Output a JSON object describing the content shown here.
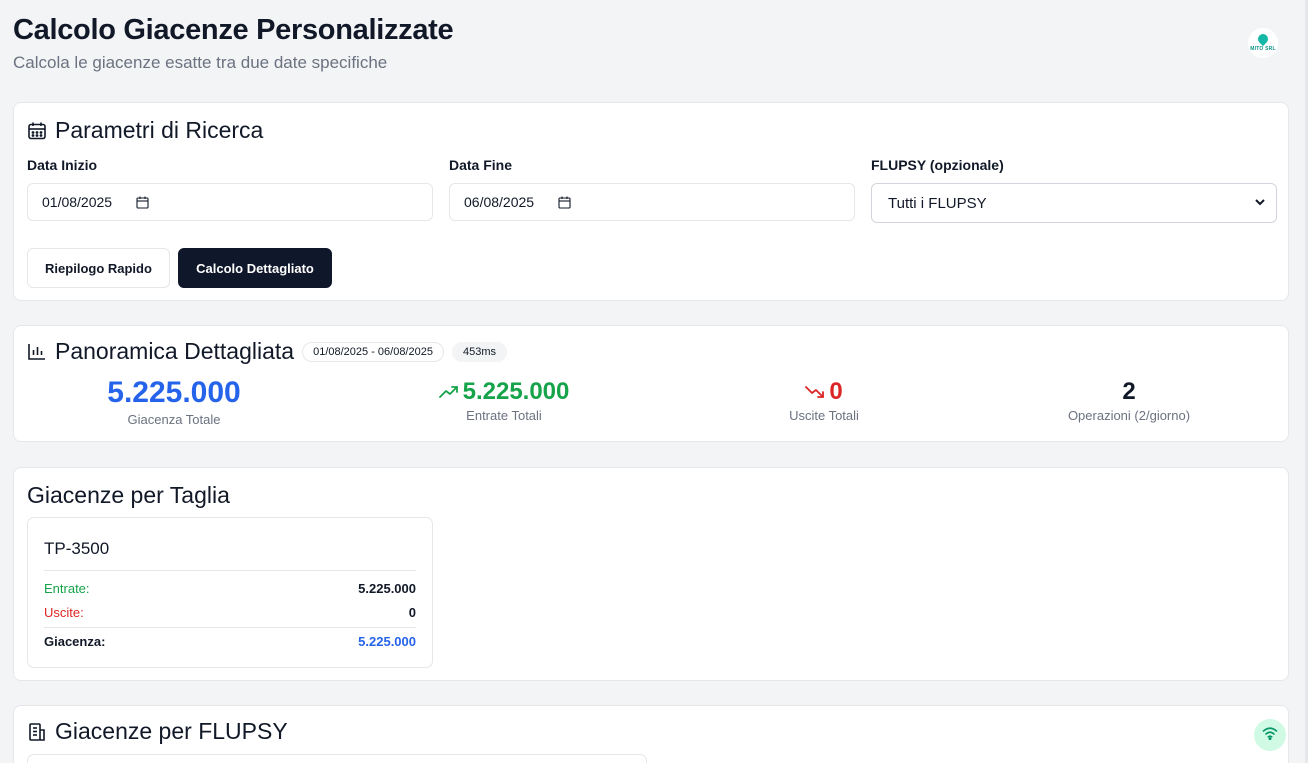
{
  "header": {
    "title": "Calcolo Giacenze Personalizzate",
    "subtitle": "Calcola le giacenze esatte tra due date specifiche",
    "logo_text": "MITO SRL"
  },
  "search": {
    "title": "Parametri di Ricerca",
    "icon": "calendar-icon",
    "start_label": "Data Inizio",
    "start_value": "01/08/2025",
    "end_label": "Data Fine",
    "end_value": "06/08/2025",
    "flupsy_label": "FLUPSY (opzionale)",
    "flupsy_value": "Tutti i FLUPSY",
    "quick_button": "Riepilogo Rapido",
    "detail_button": "Calcolo Dettagliato"
  },
  "overview": {
    "title": "Panoramica Dettagliata",
    "icon": "bar-chart-icon",
    "date_range": "01/08/2025 - 06/08/2025",
    "duration": "453ms",
    "total_value": "5.225.000",
    "total_label": "Giacenza Totale",
    "in_value": "5.225.000",
    "in_label": "Entrate Totali",
    "out_value": "0",
    "out_label": "Uscite Totali",
    "ops_value": "2",
    "ops_label": "Operazioni (2/giorno)"
  },
  "sizes": {
    "title": "Giacenze per Taglia",
    "items": [
      {
        "name": "TP-3500",
        "in_label": "Entrate:",
        "in_value": "5.225.000",
        "out_label": "Uscite:",
        "out_value": "0",
        "stock_label": "Giacenza:",
        "stock_value": "5.225.000"
      }
    ]
  },
  "flupsy": {
    "title": "Giacenze per FLUPSY",
    "icon": "building-icon"
  },
  "colors": {
    "blue": "#2563eb",
    "green": "#16a34a",
    "red": "#dc2626",
    "dark_button": "#0f172a"
  }
}
